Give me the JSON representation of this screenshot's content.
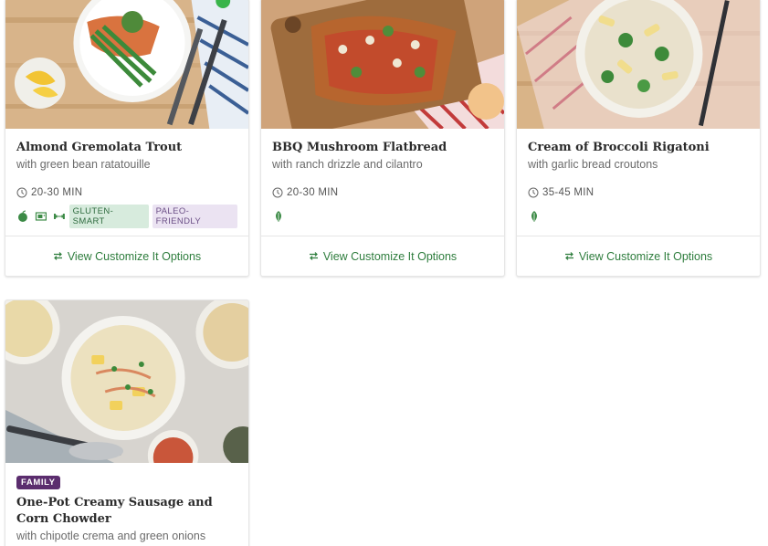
{
  "cards": [
    {
      "title": "Almond Gremolata Trout",
      "subtitle": "with green bean ratatouille",
      "time": "20-30 MIN",
      "icons": [
        "apple-icon",
        "oven-icon",
        "dumbbell-icon"
      ],
      "badges": [
        "GLUTEN-SMART",
        "PALEO-FRIENDLY"
      ],
      "action": "View Customize It Options"
    },
    {
      "title": "BBQ Mushroom Flatbread",
      "subtitle": "with ranch drizzle and cilantro",
      "time": "20-30 MIN",
      "icons": [
        "leaf-icon"
      ],
      "action": "View Customize It Options"
    },
    {
      "title": "Cream of Broccoli Rigatoni",
      "subtitle": "with garlic bread croutons",
      "time": "35-45 MIN",
      "icons": [
        "leaf-icon"
      ],
      "action": "View Customize It Options"
    },
    {
      "label": "FAMILY",
      "title": "One-Pot Creamy Sausage and Corn Chowder",
      "subtitle": "with chipotle crema and green onions"
    }
  ],
  "colors": {
    "accent_green": "#2e7d3d",
    "family_purple": "#5b2d6e",
    "gluten_badge_bg": "#d7ebdd",
    "paleo_badge_bg": "#ebe3f2"
  }
}
